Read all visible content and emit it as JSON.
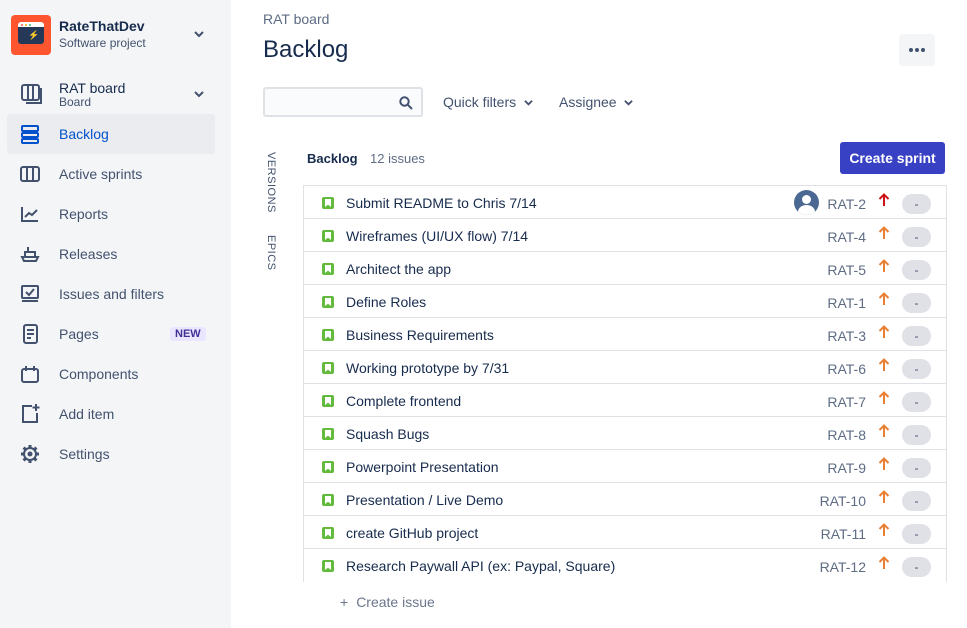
{
  "project": {
    "name": "RateThatDev",
    "type": "Software project"
  },
  "board": {
    "name": "RAT board",
    "type": "Board"
  },
  "nav": [
    {
      "label": "Backlog",
      "icon": "backlog-icon",
      "active": true
    },
    {
      "label": "Active sprints",
      "icon": "active-sprints-icon"
    },
    {
      "label": "Reports",
      "icon": "reports-icon"
    },
    {
      "label": "Releases",
      "icon": "releases-icon"
    },
    {
      "label": "Issues and filters",
      "icon": "issues-icon"
    },
    {
      "label": "Pages",
      "icon": "pages-icon",
      "badge": "NEW"
    },
    {
      "label": "Components",
      "icon": "components-icon"
    },
    {
      "label": "Add item",
      "icon": "add-item-icon"
    },
    {
      "label": "Settings",
      "icon": "settings-icon"
    }
  ],
  "header": {
    "breadcrumb": "RAT board",
    "title": "Backlog"
  },
  "filters": {
    "search_value": "",
    "quick_filters": "Quick filters",
    "assignee": "Assignee"
  },
  "side_tabs": {
    "versions": "VERSIONS",
    "epics": "EPICS"
  },
  "backlog": {
    "title": "Backlog",
    "count": "12 issues",
    "create_sprint": "Create sprint",
    "create_issue": "Create issue",
    "issues": [
      {
        "summary": "Submit README to Chris 7/14",
        "key": "RAT-2",
        "priority": "high",
        "estimate": "-",
        "assignee": true
      },
      {
        "summary": "Wireframes (UI/UX flow) 7/14",
        "key": "RAT-4",
        "priority": "medium",
        "estimate": "-"
      },
      {
        "summary": "Architect the app",
        "key": "RAT-5",
        "priority": "medium",
        "estimate": "-"
      },
      {
        "summary": "Define Roles",
        "key": "RAT-1",
        "priority": "medium",
        "estimate": "-"
      },
      {
        "summary": "Business Requirements",
        "key": "RAT-3",
        "priority": "medium",
        "estimate": "-"
      },
      {
        "summary": "Working prototype by 7/31",
        "key": "RAT-6",
        "priority": "medium",
        "estimate": "-"
      },
      {
        "summary": "Complete frontend",
        "key": "RAT-7",
        "priority": "medium",
        "estimate": "-"
      },
      {
        "summary": "Squash Bugs",
        "key": "RAT-8",
        "priority": "medium",
        "estimate": "-"
      },
      {
        "summary": "Powerpoint Presentation",
        "key": "RAT-9",
        "priority": "medium",
        "estimate": "-"
      },
      {
        "summary": "Presentation / Live Demo",
        "key": "RAT-10",
        "priority": "medium",
        "estimate": "-"
      },
      {
        "summary": "create GitHub project",
        "key": "RAT-11",
        "priority": "medium",
        "estimate": "-"
      },
      {
        "summary": "Research Paywall API (ex: Paypal, Square)",
        "key": "RAT-12",
        "priority": "medium",
        "estimate": "-"
      }
    ]
  },
  "colors": {
    "accent": "#0052CC",
    "button": "#3840C4",
    "story": "#63BA3C",
    "priority_high": "#CD1317",
    "priority_medium": "#E97F33"
  }
}
